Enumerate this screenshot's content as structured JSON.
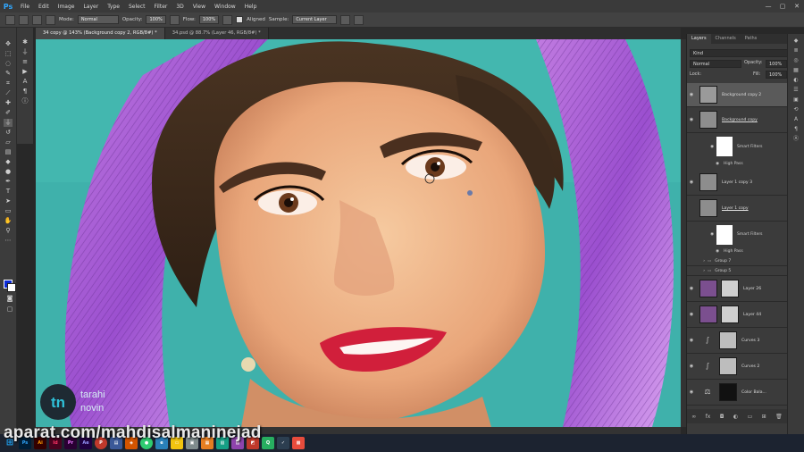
{
  "app": {
    "logo": "Ps"
  },
  "menu": [
    "File",
    "Edit",
    "Image",
    "Layer",
    "Type",
    "Select",
    "Filter",
    "3D",
    "View",
    "Window",
    "Help"
  ],
  "options": {
    "mode_label": "Mode:",
    "mode_value": "Normal",
    "opacity_label": "Opacity:",
    "opacity_value": "100%",
    "flow_label": "Flow:",
    "flow_value": "100%",
    "aligned_label": "Aligned",
    "sample_label": "Sample:",
    "sample_value": "Current Layer"
  },
  "tabs": [
    {
      "label": "34 copy @ 143% (Background copy 2, RGB/8#) *"
    },
    {
      "label": "34.psd @ 88.7% (Layer 46, RGB/8#) *"
    }
  ],
  "panel": {
    "tabs": [
      "Layers",
      "Channels",
      "Paths"
    ],
    "kind": "Kind",
    "blend": "Normal",
    "opacity_label": "Opacity:",
    "opacity_value": "100%",
    "lock_label": "Lock:",
    "fill_label": "Fill:",
    "fill_value": "100%",
    "layers": [
      {
        "name": "Background copy 2"
      },
      {
        "name": "Background copy"
      },
      {
        "name": "Smart Filters"
      },
      {
        "name": "High Pass"
      },
      {
        "name": "Layer 1 copy 3"
      },
      {
        "name": "Layer 1 copy"
      },
      {
        "name": "Smart Filters"
      },
      {
        "name": "High Pass"
      },
      {
        "name": "Group 7"
      },
      {
        "name": "Group 5"
      },
      {
        "name": "Layer 26"
      },
      {
        "name": "Layer 44"
      },
      {
        "name": "Curves 3"
      },
      {
        "name": "Curves 2"
      },
      {
        "name": "Color Bala..."
      }
    ]
  },
  "watermark": {
    "url": "aparat.com/mahdisalmaninejad",
    "brand_line1": "tarahi",
    "brand_line2": "novin",
    "brand_mark": "tn"
  },
  "window_controls": [
    "—",
    "▢",
    "✕"
  ]
}
